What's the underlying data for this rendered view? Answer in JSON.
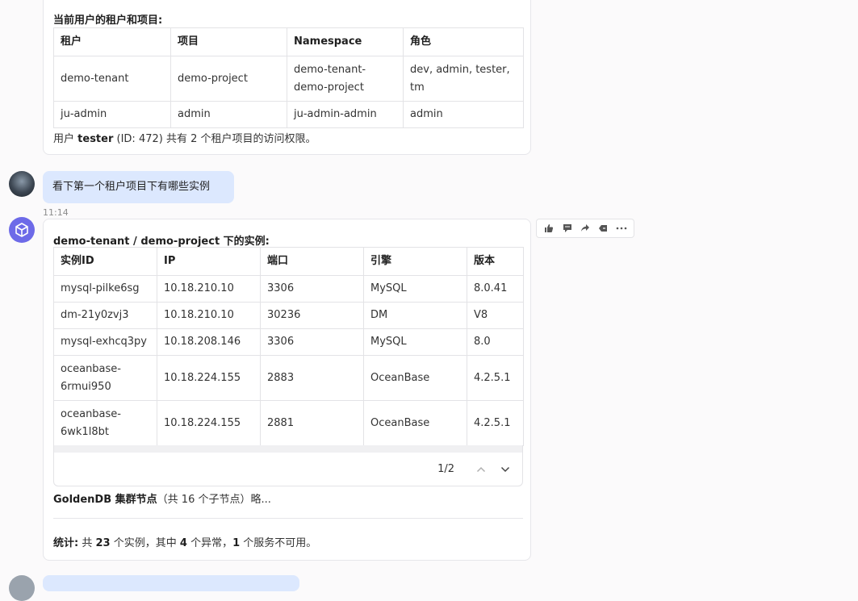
{
  "card1": {
    "title": "当前用户的租户和项目:",
    "headers": [
      "租户",
      "项目",
      "Namespace",
      "角色"
    ],
    "rows": [
      [
        "demo-tenant",
        "demo-project",
        "demo-tenant-demo-project",
        "dev, admin, tester, tm"
      ],
      [
        "ju-admin",
        "admin",
        "ju-admin-admin",
        "admin"
      ]
    ],
    "summary": {
      "prefix": "用户",
      "user": "tester",
      "id_text": "(ID: 472) 共有 2 个租户项目的访问权限。"
    }
  },
  "user_message": {
    "text": "看下第一个租户项目下有哪些实例",
    "time": "11:14"
  },
  "bot_message": {
    "title": "demo-tenant / demo-project 下的实例:",
    "headers": [
      "实例ID",
      "IP",
      "端口",
      "引擎",
      "版本"
    ],
    "rows": [
      [
        "mysql-pilke6sg",
        "10.18.210.10",
        "3306",
        "MySQL",
        "8.0.41"
      ],
      [
        "dm-21y0zvj3",
        "10.18.210.10",
        "30236",
        "DM",
        "V8"
      ],
      [
        "mysql-exhcq3py",
        "10.18.208.146",
        "3306",
        "MySQL",
        "8.0"
      ],
      [
        "oceanbase-6rmui950",
        "10.18.224.155",
        "2883",
        "OceanBase",
        "4.2.5.1"
      ],
      [
        "oceanbase-6wk1l8bt",
        "10.18.224.155",
        "2881",
        "OceanBase",
        "4.2.5.1"
      ]
    ],
    "pager": "1/2",
    "goldendb": {
      "bold": "GoldenDB 集群节点",
      "rest": "（共 16 个子节点）略..."
    },
    "stats": {
      "label": "统计:",
      "t1": "共",
      "total": "23",
      "t2": "个实例，其中",
      "abnormal": "4",
      "t3": "个异常，",
      "unavailable": "1",
      "t4": "个服务不可用。"
    }
  },
  "actions": [
    "thumbs-up-icon",
    "comment-icon",
    "share-icon",
    "tag-icon",
    "more-icon"
  ],
  "colors": {
    "bubble": "#dce8fe",
    "bot_avatar": "#6d6ae8"
  }
}
